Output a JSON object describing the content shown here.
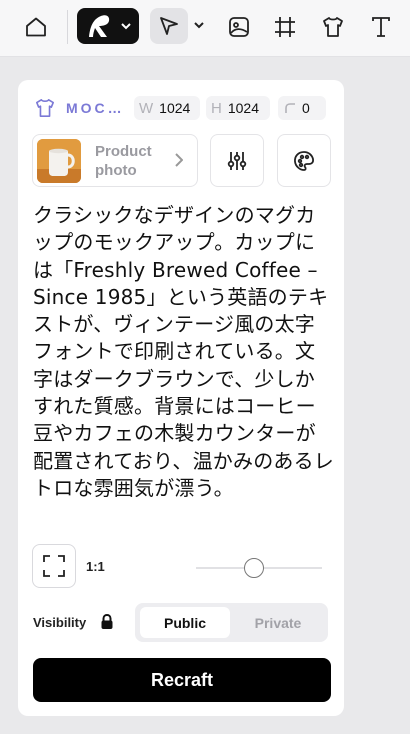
{
  "toolbar": {
    "items": [
      {
        "icon": "home-icon"
      },
      {
        "icon": "recraft-logo-icon",
        "has_dropdown": true
      },
      {
        "icon": "pointer-icon",
        "has_dropdown": true,
        "active": true
      },
      {
        "icon": "image-icon"
      },
      {
        "icon": "crop-frame-icon"
      },
      {
        "icon": "tshirt-icon"
      },
      {
        "icon": "text-icon"
      }
    ]
  },
  "panel": {
    "type_label": "MOC…",
    "dimensions": {
      "width_key": "W",
      "width_value": "1024",
      "height_key": "H",
      "height_value": "1024",
      "radius_value": "0"
    },
    "style": {
      "name": "Product photo",
      "thumbnail": "coffee-mug-thumbnail"
    },
    "prompt": "クラシックなデザインのマグカップのモックアップ。カップには「Freshly Brewed Coffee – Since 1985」という英語のテキストが、ヴィンテージ風の太字フォントで印刷されている。文字はダークブラウンで、少しかすれた質感。背景にはコーヒー豆やカフェの木製カウンターが配置されており、温かみのあるレトロな雰囲気が漂う。",
    "aspect_ratio": "1:1",
    "visibility": {
      "label": "Visibility",
      "options": [
        "Public",
        "Private"
      ],
      "selected": "Public"
    },
    "submit_label": "Recraft"
  },
  "colors": {
    "accent_label": "#7b79d6",
    "primary_button": "#000000",
    "thumbnail_bg": "#e19b3f"
  }
}
